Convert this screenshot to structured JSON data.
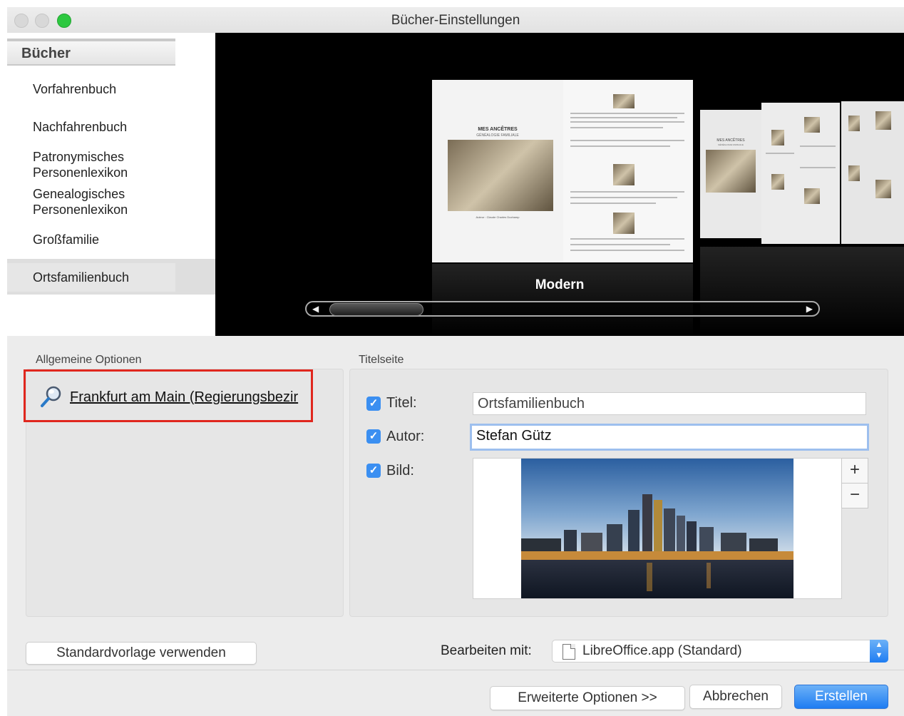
{
  "window": {
    "title": "Bücher-Einstellungen"
  },
  "sidebar": {
    "header": "Bücher",
    "items": [
      {
        "label": "Vorfahrenbuch"
      },
      {
        "label": "Nachfahrenbuch"
      },
      {
        "label": "Patronymisches\nPersonenlexikon"
      },
      {
        "label": "Genealogisches\nPersonenlexikon"
      },
      {
        "label": "Großfamilie"
      },
      {
        "label": "Ortsfamilienbuch"
      }
    ],
    "selected": "Ortsfamilienbuch"
  },
  "preview": {
    "style_name": "Modern",
    "book_title": "MES ANCÊTRES",
    "book_subtitle": "GÉNÉALOGIE FAMILIALE",
    "book_author_line": "Auteur : Claude Charles Duchamp",
    "side_book_title": "MES ANCÊTRES",
    "side_book_subtitle": "GÉNÉALOGIE FAMILIALE"
  },
  "general_options": {
    "label": "Allgemeine Optionen",
    "place_link": "Frankfurt am Main (Regierungsbezir",
    "icon": "magnifier-icon"
  },
  "title_page": {
    "label": "Titelseite",
    "title_checkbox": {
      "label": "Titel:",
      "checked": true,
      "value": "Ortsfamilienbuch"
    },
    "author_checkbox": {
      "label": "Autor:",
      "checked": true,
      "value": "Stefan Gütz"
    },
    "image_checkbox": {
      "label": "Bild:",
      "checked": true
    },
    "add_image": "+",
    "remove_image": "−"
  },
  "footer": {
    "default_template_button": "Standardvorlage verwenden",
    "edit_with_label": "Bearbeiten mit:",
    "edit_with_value": "LibreOffice.app (Standard)",
    "advanced_button": "Erweiterte Optionen >>",
    "cancel_button": "Abbrechen",
    "create_button": "Erstellen"
  },
  "colors": {
    "accent": "#1f7df2",
    "highlight": "#e0271e",
    "zoom": "#2dc840"
  }
}
